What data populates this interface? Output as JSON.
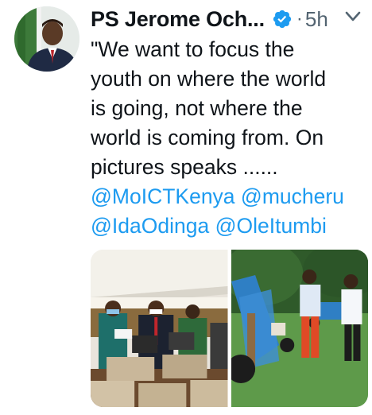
{
  "tweet": {
    "author_name": "PS Jerome Och...",
    "verified": true,
    "separator": "·",
    "time": "5h",
    "text_lines": [
      "\"We want to focus the",
      "youth on where the world",
      "is going, not where the",
      "world is coming from. On",
      "pictures speaks ......"
    ],
    "mentions_line1": [
      "@MoICTKenya",
      "@mucheru"
    ],
    "mentions_line2": [
      "@IdaOdinga",
      "@OleItumbi"
    ]
  },
  "icons": {
    "verified": "verified-badge-icon",
    "more": "chevron-down-icon"
  },
  "colors": {
    "link": "#1d9bf0",
    "text": "#0f1419",
    "muted": "#536471"
  }
}
